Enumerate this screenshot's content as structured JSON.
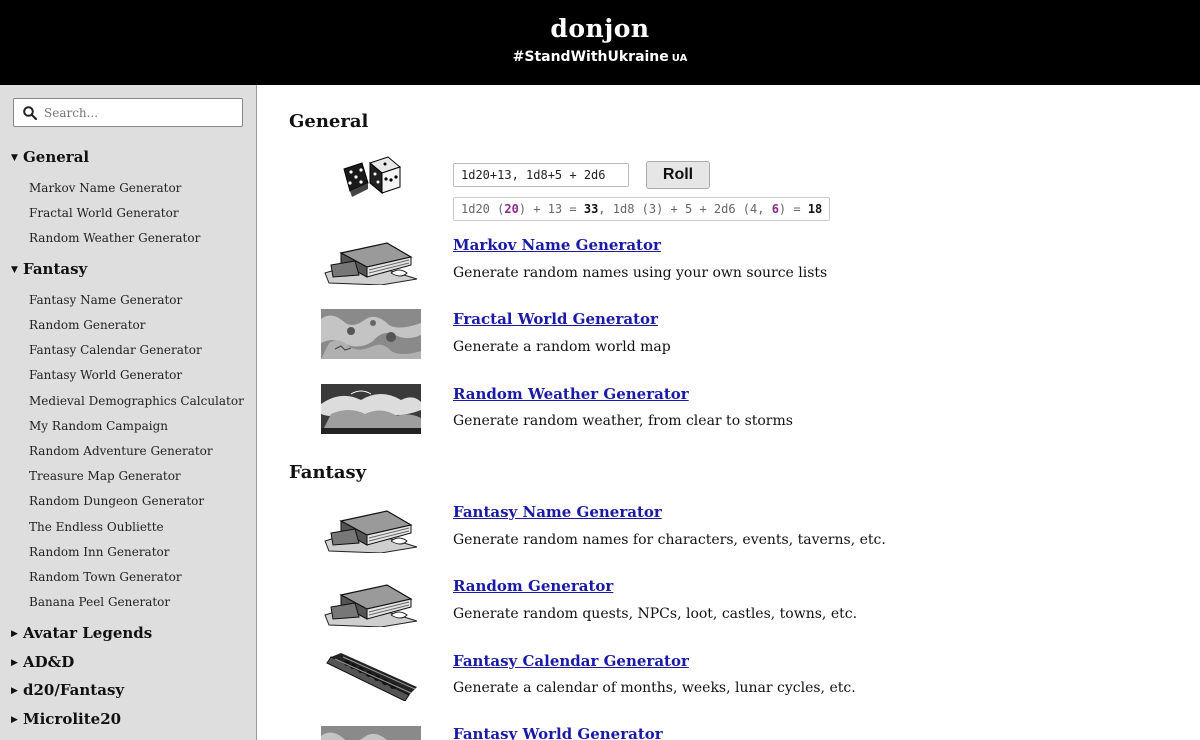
{
  "header": {
    "title": "donjon",
    "subtitle": "#StandWithUkraine",
    "subtitle_flag": "UA"
  },
  "sidebar": {
    "search_placeholder": "Search...",
    "groups": [
      {
        "label": "General",
        "expanded": true,
        "items": [
          "Markov Name Generator",
          "Fractal World Generator",
          "Random Weather Generator"
        ]
      },
      {
        "label": "Fantasy",
        "expanded": true,
        "items": [
          "Fantasy Name Generator",
          "Random Generator",
          "Fantasy Calendar Generator",
          "Fantasy World Generator",
          "Medieval Demographics Calculator",
          "My Random Campaign",
          "Random Adventure Generator",
          "Treasure Map Generator",
          "Random Dungeon Generator",
          "The Endless Oubliette",
          "Random Inn Generator",
          "Random Town Generator",
          "Banana Peel Generator"
        ]
      },
      {
        "label": "Avatar Legends",
        "expanded": false,
        "items": []
      },
      {
        "label": "AD&D",
        "expanded": false,
        "items": []
      },
      {
        "label": "d20/Fantasy",
        "expanded": false,
        "items": []
      },
      {
        "label": "Microlite20",
        "expanded": false,
        "items": []
      }
    ]
  },
  "main": {
    "sections": [
      {
        "title": "General"
      },
      {
        "title": "Fantasy"
      }
    ],
    "dice": {
      "input_value": "1d20+13, 1d8+5 + 2d6",
      "roll_label": "Roll",
      "result": {
        "p1": "1d20 (",
        "r1": "20",
        "p2": ") + 13 = ",
        "t1": "33",
        "p3": ", 1d8 (3) + 5 + 2d6 (4, ",
        "r2": "6",
        "p4": ") = ",
        "t2": "18"
      }
    },
    "entries": [
      {
        "title": "Markov Name Generator",
        "desc": "Generate random names using your own source lists",
        "icon": "book-stack-icon"
      },
      {
        "title": "Fractal World Generator",
        "desc": "Generate a random world map",
        "icon": "world-map-icon"
      },
      {
        "title": "Random Weather Generator",
        "desc": "Generate random weather, from clear to storms",
        "icon": "storm-clouds-icon"
      },
      {
        "title": "Fantasy Name Generator",
        "desc": "Generate random names for characters, events, taverns, etc.",
        "icon": "book-stack-icon"
      },
      {
        "title": "Random Generator",
        "desc": "Generate random quests, NPCs, loot, castles, towns, etc.",
        "icon": "book-stack-icon"
      },
      {
        "title": "Fantasy Calendar Generator",
        "desc": "Generate a calendar of months, weeks, lunar cycles, etc.",
        "icon": "abacus-icon"
      },
      {
        "title": "Fantasy World Generator",
        "desc": "",
        "icon": "world-map-icon"
      }
    ]
  },
  "colors": {
    "header_bg": "#000000",
    "sidebar_bg": "#dedede",
    "link": "#1a1aa6",
    "dice_highlight": "#8a2a8a"
  }
}
